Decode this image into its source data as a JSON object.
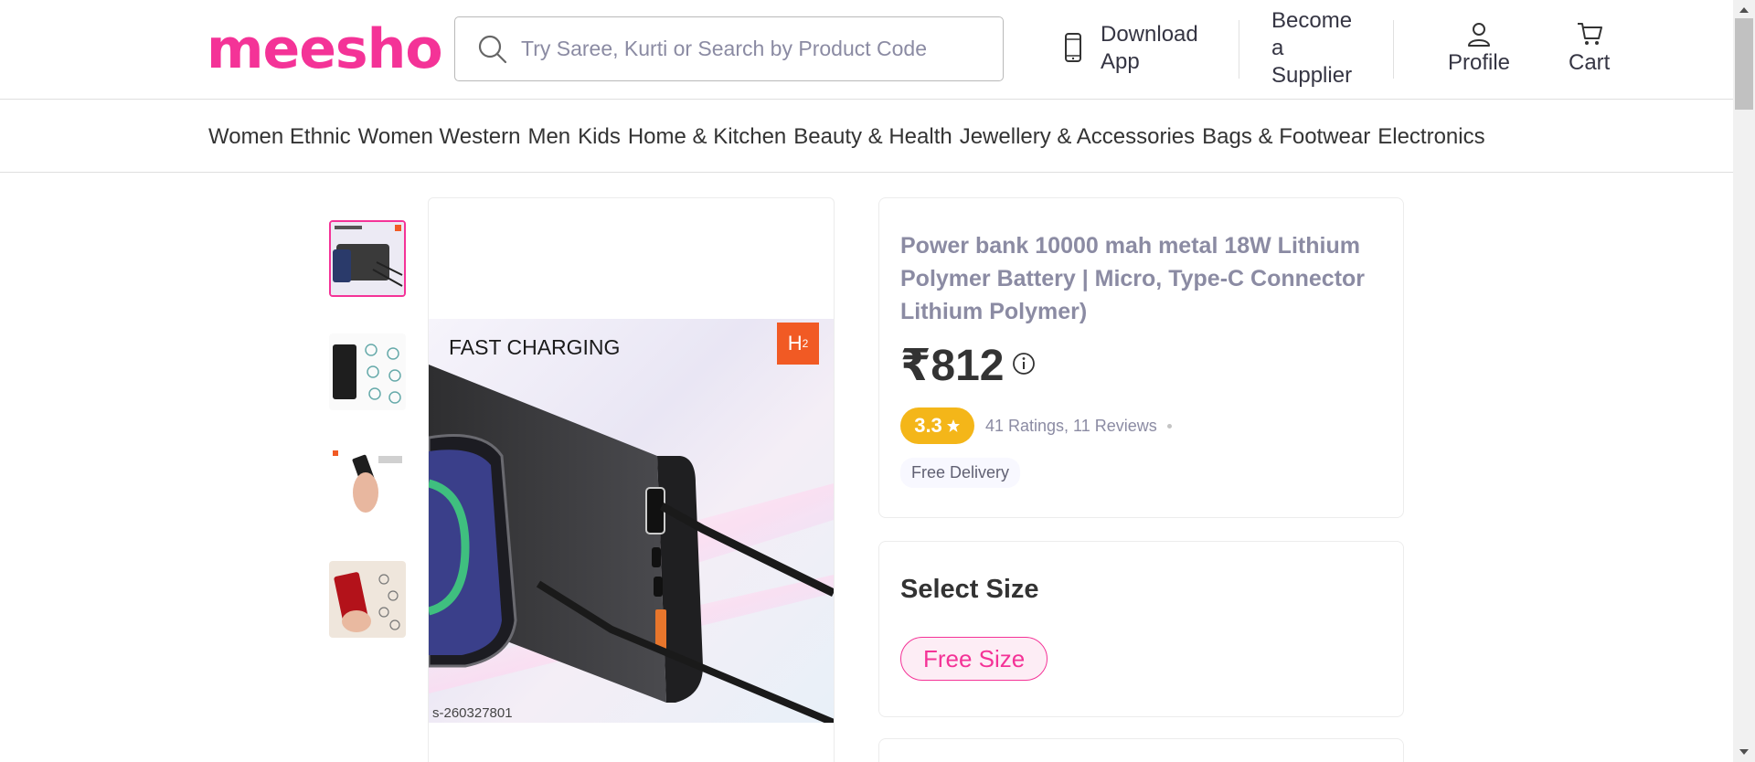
{
  "header": {
    "logo": "meesho",
    "search": {
      "placeholder": "Try Saree, Kurti or Search by Product Code"
    },
    "download_app": [
      "Download",
      "App"
    ],
    "become_supplier": [
      "Become",
      "a",
      "Supplier"
    ],
    "profile": "Profile",
    "cart": "Cart"
  },
  "categories": [
    "Women Ethnic",
    "Women Western",
    "Men",
    "Kids",
    "Home & Kitchen",
    "Beauty & Health",
    "Jewellery & Accessories",
    "Bags & Footwear",
    "Electronics"
  ],
  "main_image": {
    "label": "FAST CHARGING",
    "badge": "H",
    "sku": "s-260327801"
  },
  "product": {
    "title": "Power bank 10000 mah metal 18W Lithium Polymer Battery | Micro, Type-C Connector Lithium Polymer)",
    "price": "₹812",
    "rating": "3.3",
    "ratings_reviews": "41 Ratings, 11 Reviews",
    "delivery": "Free Delivery"
  },
  "size": {
    "title": "Select Size",
    "options": [
      "Free Size"
    ]
  },
  "colors": {
    "brand": "#f43397",
    "rating": "#f4b619"
  }
}
